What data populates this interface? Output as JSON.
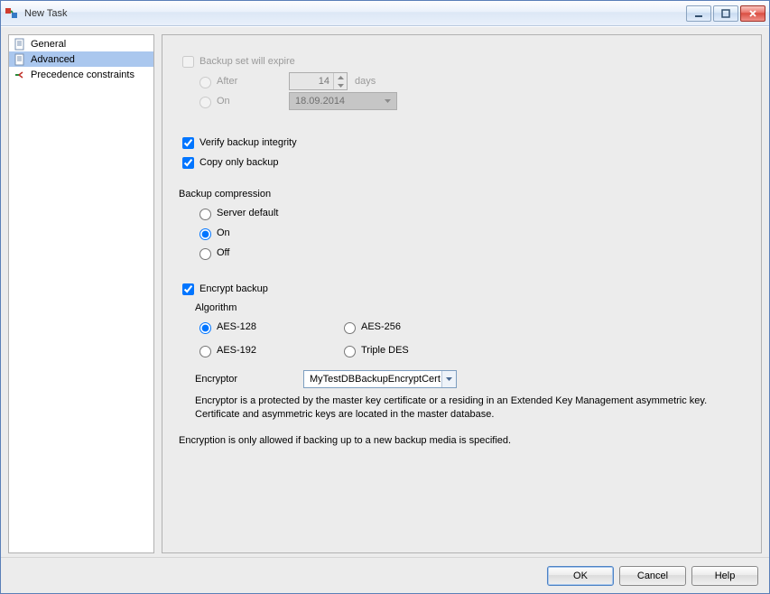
{
  "window": {
    "title": "New Task"
  },
  "nav": {
    "items": [
      {
        "label": "General"
      },
      {
        "label": "Advanced"
      },
      {
        "label": "Precedence constraints"
      }
    ],
    "selected_index": 1
  },
  "expiry": {
    "checkbox_label": "Backup set will expire",
    "after_label": "After",
    "after_days": "14",
    "after_unit": "days",
    "on_label": "On",
    "on_date": "18.09.2014"
  },
  "verify": {
    "label": "Verify backup integrity",
    "checked": true
  },
  "copyonly": {
    "label": "Copy only backup",
    "checked": true
  },
  "compression": {
    "title": "Backup compression",
    "options": {
      "server_default": "Server default",
      "on": "On",
      "off": "Off"
    },
    "selected": "on"
  },
  "encrypt": {
    "label": "Encrypt backup",
    "checked": true,
    "algorithm_title": "Algorithm",
    "algorithms": {
      "aes128": "AES-128",
      "aes192": "AES-192",
      "aes256": "AES-256",
      "tripledes": "Triple DES"
    },
    "algorithm_selected": "aes128",
    "encryptor_label": "Encryptor",
    "encryptor_value": "MyTestDBBackupEncryptCert",
    "note": "Encryptor is a protected by the master key certificate or a residing in an Extended Key Management asymmetric key. Certificate and asymmetric keys are located in the master database.",
    "note2": "Encryption is only allowed if backing up to a new backup media is specified."
  },
  "buttons": {
    "ok": "OK",
    "cancel": "Cancel",
    "help": "Help"
  }
}
